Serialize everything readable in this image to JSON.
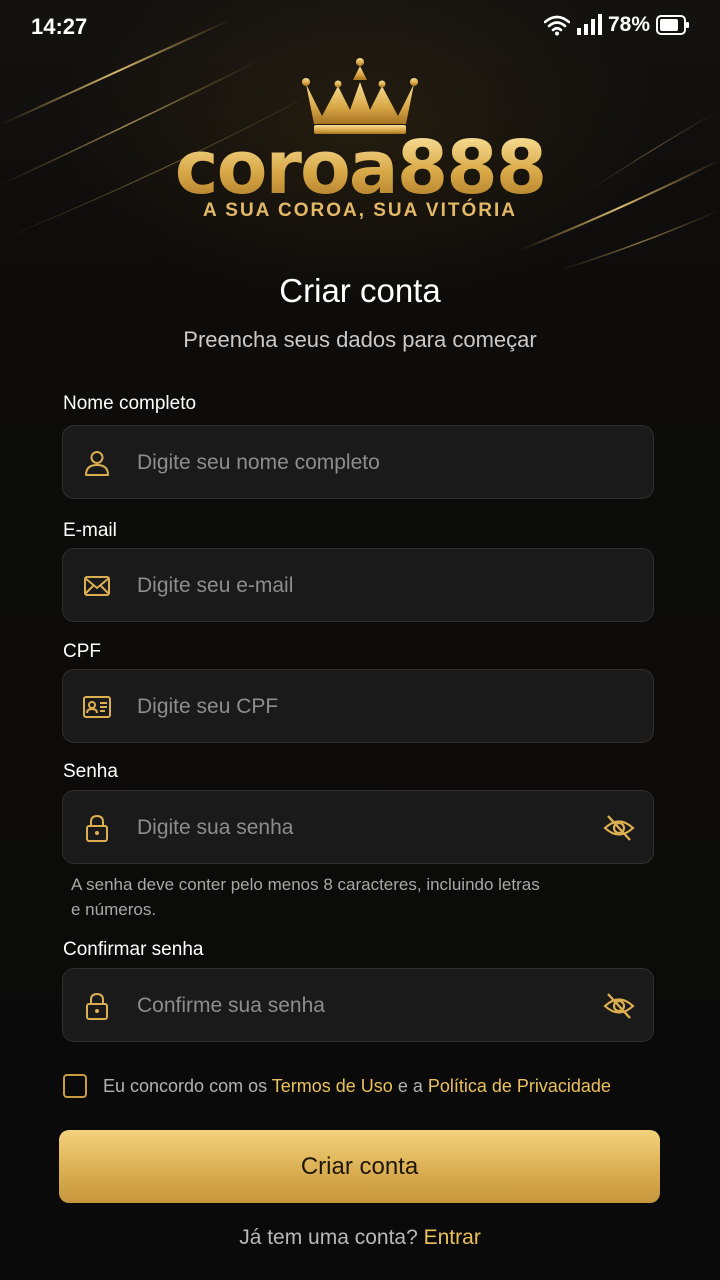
{
  "status_bar": {
    "time": "14:27",
    "battery": "78%"
  },
  "brand": {
    "name": "coroa888",
    "tagline": "A SUA COROA, SUA VITÓRIA"
  },
  "form": {
    "title": "Criar conta",
    "subtitle": "Preencha seus dados para começar",
    "name": {
      "label": "Nome completo",
      "placeholder": "Digite seu nome completo",
      "value": ""
    },
    "email": {
      "label": "E-mail",
      "placeholder": "Digite seu e-mail",
      "value": ""
    },
    "cpf": {
      "label": "CPF",
      "placeholder": "Digite seu CPF",
      "value": ""
    },
    "password": {
      "label": "Senha",
      "placeholder": "Digite sua senha",
      "value": "",
      "hint": "A senha deve conter pelo menos 8 caracteres, incluindo letras e números."
    },
    "confirm": {
      "label": "Confirmar senha",
      "placeholder": "Confirme sua senha",
      "value": ""
    },
    "terms": {
      "checked": false,
      "prefix": "Eu concordo com os ",
      "terms_link": "Termos de Uso",
      "middle": " e a ",
      "privacy_link": "Política de Privacidade"
    },
    "submit_label": "Criar conta",
    "login_prompt": "Já tem uma conta?",
    "login_link": "Entrar"
  },
  "colors": {
    "gold": "#e3b75a",
    "background": "#0b0b0b",
    "field": "#1a1a1a"
  },
  "icons": [
    "wifi-icon",
    "signal-icon",
    "battery-icon",
    "crown-icon",
    "user-icon",
    "mail-icon",
    "id-card-icon",
    "lock-icon",
    "eye-off-icon"
  ]
}
